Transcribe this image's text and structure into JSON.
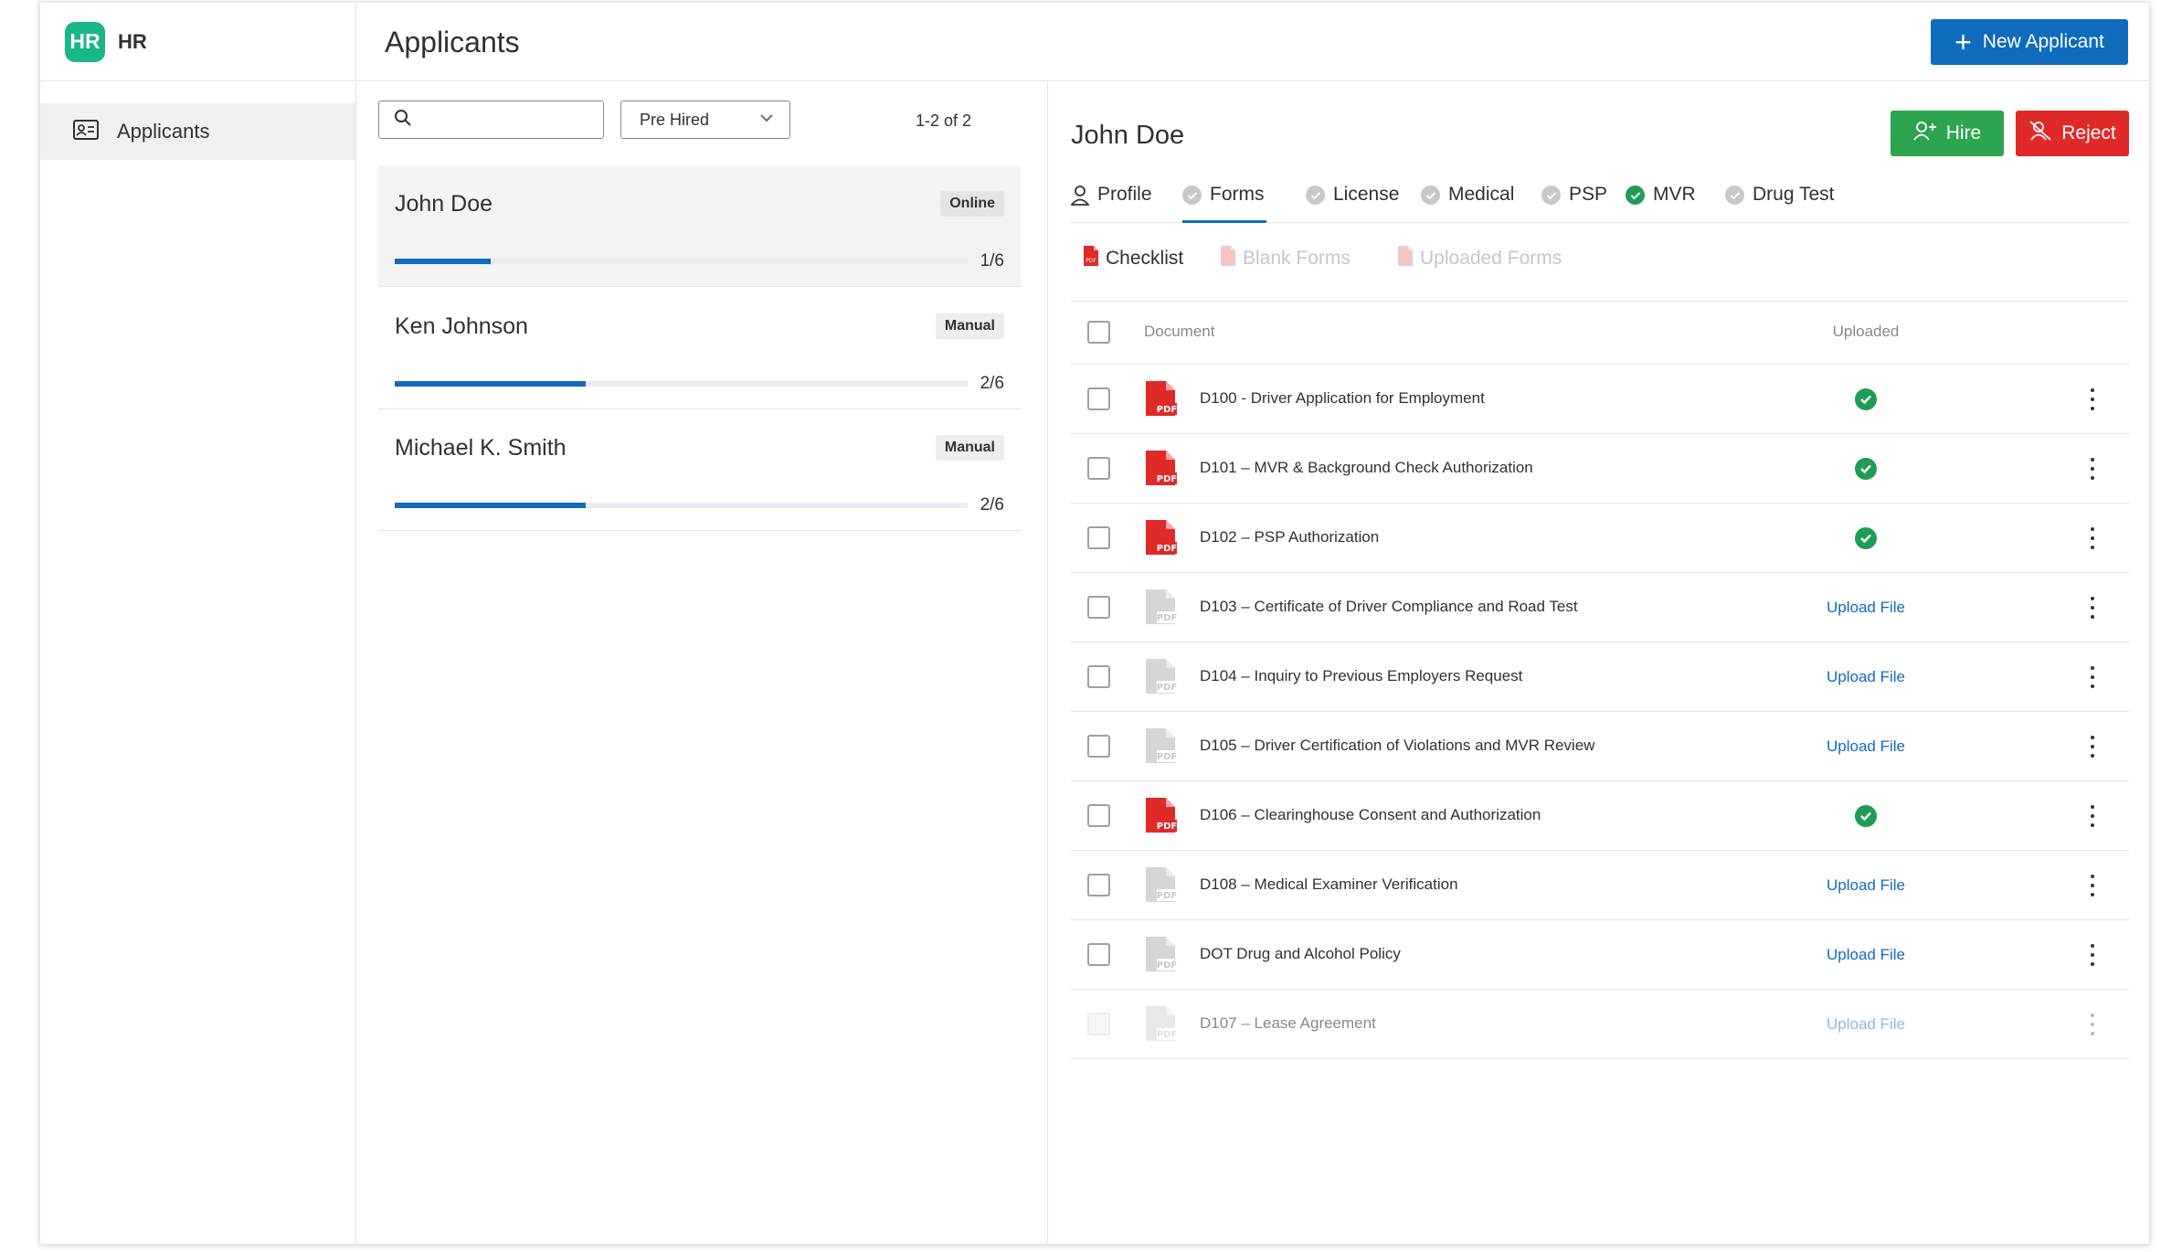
{
  "app": {
    "logo_text": "HR",
    "brand": "HR"
  },
  "nav": {
    "items": [
      {
        "label": "Applicants",
        "icon": "contact-card-icon"
      }
    ]
  },
  "header": {
    "title": "Applicants",
    "new_button": "New Applicant"
  },
  "list": {
    "search_placeholder": "",
    "filter_value": "Pre Hired",
    "count": "1-2 of 2",
    "applicants": [
      {
        "name": "John Doe",
        "badge": "Online",
        "progress": "1/6",
        "progress_value": 0.167,
        "selected": true
      },
      {
        "name": "Ken Johnson",
        "badge": "Manual",
        "progress": "2/6",
        "progress_value": 0.333,
        "selected": false
      },
      {
        "name": "Michael K. Smith",
        "badge": "Manual",
        "progress": "2/6",
        "progress_value": 0.333,
        "selected": false
      }
    ]
  },
  "detail": {
    "name": "John Doe",
    "hire_button": "Hire",
    "reject_button": "Reject",
    "tabs": [
      {
        "label": "Profile",
        "icon": "person-icon",
        "state": "none"
      },
      {
        "label": "Forms",
        "icon": "check-circle-icon",
        "state": "pending",
        "active": true
      },
      {
        "label": "License",
        "icon": "check-circle-icon",
        "state": "pending"
      },
      {
        "label": "Medical",
        "icon": "check-circle-icon",
        "state": "pending"
      },
      {
        "label": "PSP",
        "icon": "check-circle-icon",
        "state": "pending"
      },
      {
        "label": "MVR",
        "icon": "check-circle-icon",
        "state": "complete"
      },
      {
        "label": "Drug Test",
        "icon": "check-circle-icon",
        "state": "pending"
      }
    ],
    "subtabs": [
      {
        "label": "Checklist",
        "active": true
      },
      {
        "label": "Blank Forms",
        "active": false
      },
      {
        "label": "Uploaded Forms",
        "active": false
      }
    ],
    "table": {
      "col_document": "Document",
      "col_uploaded": "Uploaded",
      "rows": [
        {
          "doc": "D100 - Driver Application for Employment",
          "uploaded": true,
          "action": ""
        },
        {
          "doc": "D101 – MVR & Background Check Authorization",
          "uploaded": true,
          "action": ""
        },
        {
          "doc": "D102 – PSP Authorization",
          "uploaded": true,
          "action": ""
        },
        {
          "doc": "D103 – Certificate of Driver Compliance and Road Test",
          "uploaded": false,
          "action": "Upload File"
        },
        {
          "doc": "D104 – Inquiry to Previous Employers Request",
          "uploaded": false,
          "action": "Upload File"
        },
        {
          "doc": "D105 – Driver Certification of Violations and MVR Review",
          "uploaded": false,
          "action": "Upload File"
        },
        {
          "doc": "D106 – Clearinghouse Consent and Authorization",
          "uploaded": true,
          "action": ""
        },
        {
          "doc": "D108 – Medical Examiner Verification",
          "uploaded": false,
          "action": "Upload File"
        },
        {
          "doc": "DOT Drug and Alcohol Policy",
          "uploaded": false,
          "action": "Upload File"
        },
        {
          "doc": "D107 – Lease Agreement",
          "uploaded": false,
          "action": "Upload File",
          "disabled": true
        }
      ]
    }
  },
  "colors": {
    "accent": "#0f6cbd",
    "hire": "#2da44e",
    "reject": "#e02929",
    "logo": "#1bb58a",
    "pdf_red": "#e02929",
    "ok_green": "#1f9d55"
  }
}
